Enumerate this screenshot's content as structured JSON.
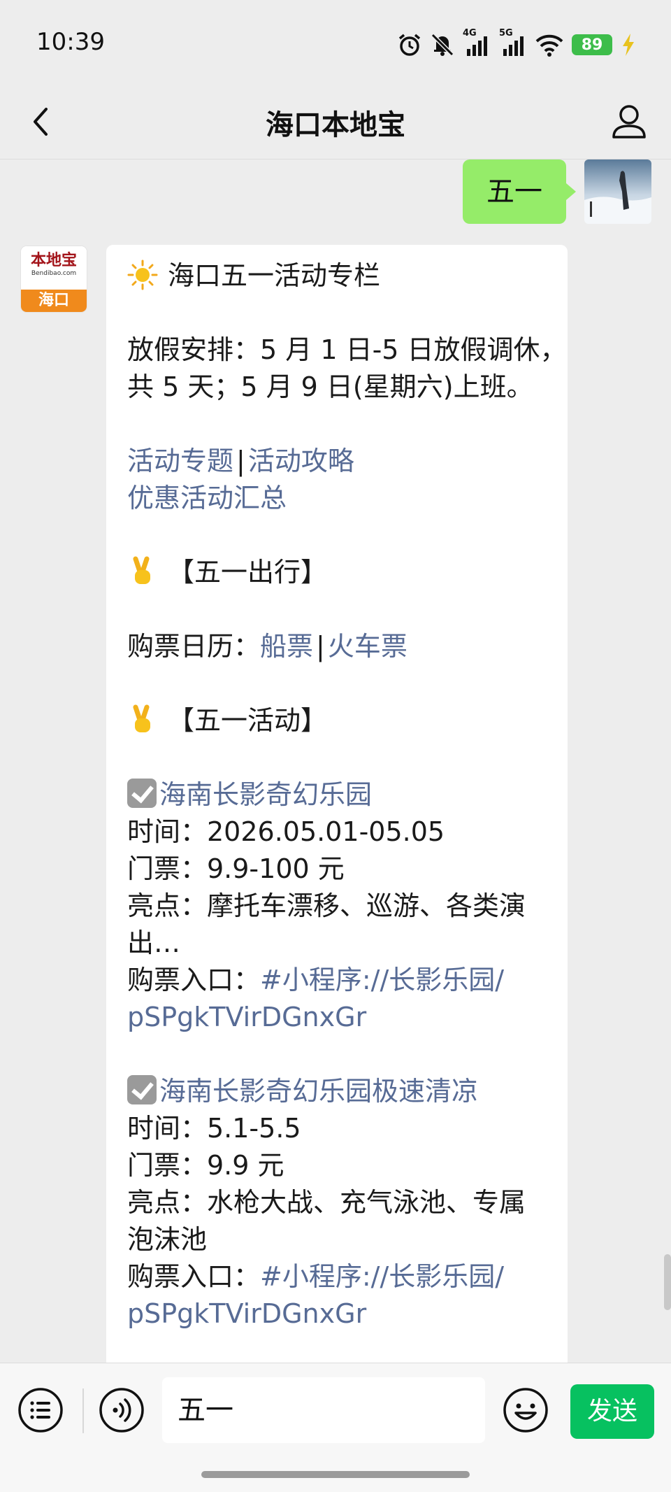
{
  "status_bar": {
    "time": "10:39",
    "net_label_1": "4G",
    "net_label_2": "5G",
    "battery": "89",
    "icons": [
      "alarm-icon",
      "mute-icon",
      "signal-4g-icon",
      "signal-5g-icon",
      "wifi-icon",
      "battery-icon",
      "charging-icon"
    ]
  },
  "nav": {
    "title": "海口本地宝",
    "icons": [
      "back-icon",
      "profile-icon"
    ]
  },
  "sent_message": {
    "text": "五一"
  },
  "bot_avatar": {
    "logo_text": "本地宝",
    "logo_domain": "Bendibao.com",
    "city": "海口"
  },
  "message": {
    "title": "海口五一活动专栏",
    "holiday_line_1": "放假安排：5 月 1 日-5 日放假调休，",
    "holiday_line_2": "共 5 天；5 月 9 日(星期六)上班。",
    "link_topic": "活动专题",
    "link_separator": "|",
    "link_guide": "活动攻略",
    "link_deals": "优惠活动汇总",
    "section_travel": "【五一出行】",
    "calendar_label": "购票日历：",
    "link_ship": "船票",
    "link_train": "火车票",
    "section_events": "【五一活动】",
    "events": [
      {
        "name": "海南长影奇幻乐园",
        "time": "时间：2026.05.01-05.05",
        "ticket": "门票：9.9-100 元",
        "highlight_1": "亮点：摩托车漂移、巡游、各类演",
        "highlight_2": "出…",
        "entry_label": "购票入口：",
        "entry_link_1": "#小程序://长影乐园/",
        "entry_link_2": "pSPgkTVirDGnxGr"
      },
      {
        "name": "海南长影奇幻乐园极速清凉",
        "time": "时间：5.1-5.5",
        "ticket": "门票：9.9 元",
        "highlight_1": "亮点：水枪大战、充气泳池、专属",
        "highlight_2": "泡沫池",
        "entry_label": "购票入口：",
        "entry_link_1": "#小程序://长影乐园/",
        "entry_link_2": "pSPgkTVirDGnxGr"
      }
    ]
  },
  "input_bar": {
    "text": "五一",
    "send_label": "发送",
    "icons": [
      "menu-icon",
      "voice-icon",
      "emoji-icon"
    ]
  },
  "colors": {
    "background": "#ededed",
    "sent_bubble": "#95ec69",
    "link": "#576b95",
    "send_button": "#07c160",
    "battery": "#3dbd4a"
  }
}
